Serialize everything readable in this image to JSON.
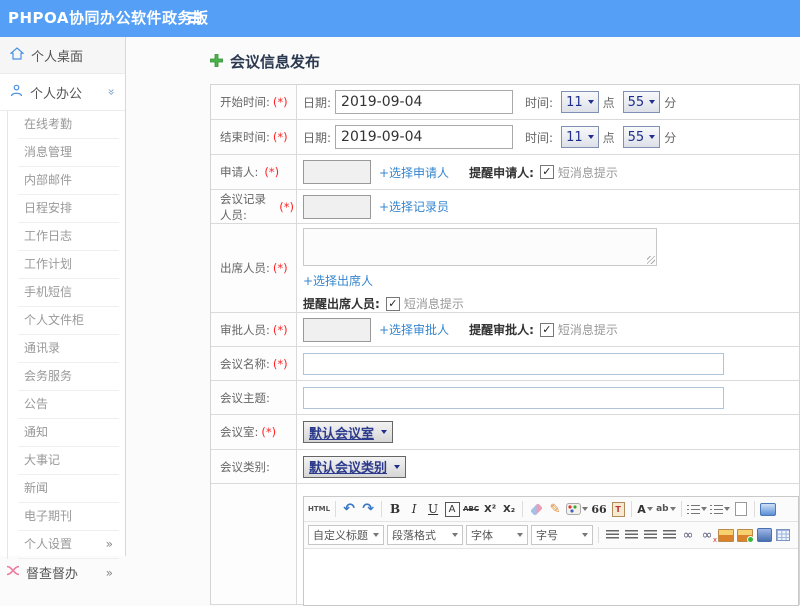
{
  "header": {
    "brand": "PHPOA协同办公软件政务版"
  },
  "icons": {
    "menu": "≡",
    "check": "✓",
    "chevron_more": "»",
    "undo": "↶",
    "redo": "↷",
    "bold": "B",
    "italic": "I",
    "underline": "U",
    "font_box": "A",
    "strike": "ABC",
    "superscript": "X²",
    "subscript": "X₂",
    "brush": "✎",
    "quote": "66",
    "paste": "T",
    "font_color": "A",
    "highlight": "ab",
    "link": "∞",
    "unlink": "∞",
    "html": "HTML"
  },
  "sidebar": {
    "desktop": "个人桌面",
    "office": "个人办公",
    "sub_items": [
      "在线考勤",
      "消息管理",
      "内部邮件",
      "日程安排",
      "工作日志",
      "工作计划",
      "手机短信",
      "个人文件柜",
      "通讯录",
      "会务服务",
      "公告",
      "通知",
      "大事记",
      "新闻",
      "电子期刊"
    ],
    "settings": "个人设置",
    "supervise": "督查督办"
  },
  "form": {
    "title": "会议信息发布",
    "required_mark": "(*)",
    "start_time": {
      "label": "开始时间:",
      "date_label": "日期:",
      "date_value": "2019-09-04",
      "time_label": "时间:",
      "hour": "11",
      "hour_unit": "点",
      "minute": "55",
      "minute_unit": "分"
    },
    "end_time": {
      "label": "结束时间:",
      "date_label": "日期:",
      "date_value": "2019-09-04",
      "time_label": "时间:",
      "hour": "11",
      "hour_unit": "点",
      "minute": "55",
      "minute_unit": "分"
    },
    "applicant": {
      "label": "申请人:",
      "value": "",
      "link": "+选择申请人",
      "remind": "提醒申请人:",
      "sms": "短消息提示"
    },
    "recorder": {
      "label": "会议记录人员:",
      "value": "",
      "link": "+选择记录员"
    },
    "attendees": {
      "label": "出席人员:",
      "value": "",
      "link": "+选择出席人",
      "remind": "提醒出席人员:",
      "sms": "短消息提示"
    },
    "approver": {
      "label": "审批人员:",
      "value": "",
      "link": "+选择审批人",
      "remind": "提醒审批人:",
      "sms": "短消息提示"
    },
    "name": {
      "label": "会议名称:",
      "value": ""
    },
    "topic": {
      "label": "会议主题:",
      "value": ""
    },
    "room": {
      "label": "会议室:",
      "value": "默认会议室"
    },
    "category": {
      "label": "会议类别:",
      "value": "默认会议类别"
    },
    "editor": {
      "dropdowns": [
        "自定义标题",
        "段落格式",
        "字体",
        "字号"
      ]
    }
  }
}
